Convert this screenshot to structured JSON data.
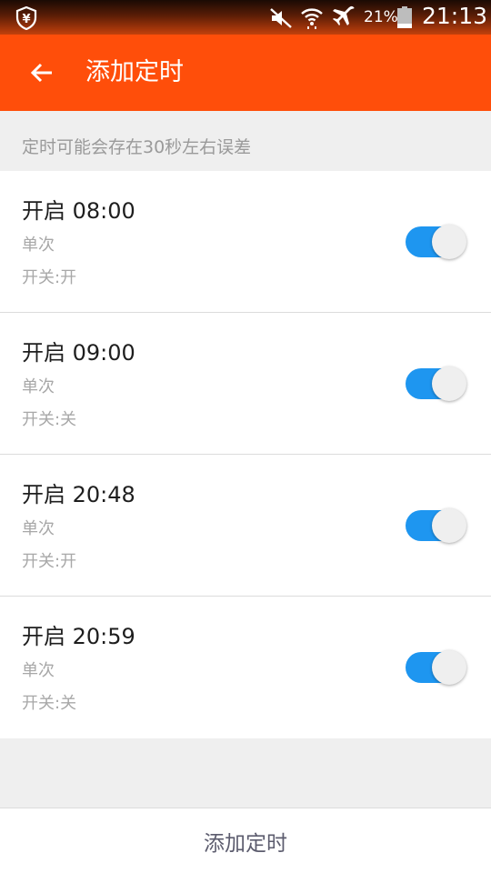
{
  "status_bar": {
    "battery_percent": "21%",
    "battery_level": 0.21,
    "time": "21:13",
    "app_badge_glyph": "¥",
    "icons": [
      "app-badge-icon",
      "mute-icon",
      "wifi-icon",
      "airplane-icon",
      "battery-icon"
    ]
  },
  "app_bar": {
    "title": "添加定时",
    "back_icon": "arrow-left-icon"
  },
  "notice": {
    "text": "定时可能会存在30秒左右误差"
  },
  "timers": [
    {
      "title": "开启 08:00",
      "repeat": "单次",
      "state": "开关:开",
      "enabled": true
    },
    {
      "title": "开启 09:00",
      "repeat": "单次",
      "state": "开关:关",
      "enabled": true
    },
    {
      "title": "开启 20:48",
      "repeat": "单次",
      "state": "开关:开",
      "enabled": true
    },
    {
      "title": "开启 20:59",
      "repeat": "单次",
      "state": "开关:关",
      "enabled": true
    }
  ],
  "bottom": {
    "add_button_label": "添加定时"
  },
  "colors": {
    "accent": "#ff4e0a",
    "toggle_on": "#1e96f0",
    "background": "#efefef"
  }
}
